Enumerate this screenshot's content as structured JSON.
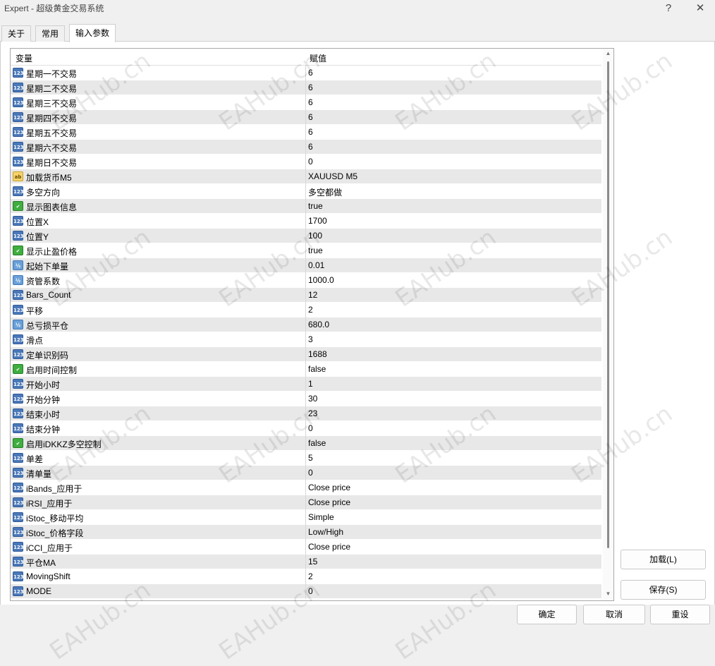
{
  "window": {
    "title": "Expert - 超级黄金交易系统",
    "help_label": "?",
    "close_label": "✕"
  },
  "tabs": [
    "关于",
    "常用",
    "输入参数"
  ],
  "grid": {
    "col_variable": "变量",
    "col_value": "赋值",
    "rows": [
      {
        "icon": "int",
        "icon_text": "123",
        "name": "星期一不交易",
        "value": "6"
      },
      {
        "icon": "int",
        "icon_text": "123",
        "name": "星期二不交易",
        "value": "6"
      },
      {
        "icon": "int",
        "icon_text": "123",
        "name": "星期三不交易",
        "value": "6"
      },
      {
        "icon": "int",
        "icon_text": "123",
        "name": "星期四不交易",
        "value": "6"
      },
      {
        "icon": "int",
        "icon_text": "123",
        "name": "星期五不交易",
        "value": "6"
      },
      {
        "icon": "int",
        "icon_text": "123",
        "name": "星期六不交易",
        "value": "6"
      },
      {
        "icon": "int",
        "icon_text": "123",
        "name": "星期日不交易",
        "value": "0"
      },
      {
        "icon": "str",
        "icon_text": "ab",
        "name": "加载货币M5",
        "value": "XAUUSD M5"
      },
      {
        "icon": "int",
        "icon_text": "123",
        "name": "多空方向",
        "value": "多空都做"
      },
      {
        "icon": "bool",
        "icon_text": "✔",
        "name": "显示图表信息",
        "value": "true"
      },
      {
        "icon": "int",
        "icon_text": "123",
        "name": "位置X",
        "value": "1700"
      },
      {
        "icon": "int",
        "icon_text": "123",
        "name": "位置Y",
        "value": "100"
      },
      {
        "icon": "bool",
        "icon_text": "✔",
        "name": "显示止盈价格",
        "value": "true"
      },
      {
        "icon": "dbl",
        "icon_text": "½",
        "name": "起始下单量",
        "value": "0.01"
      },
      {
        "icon": "dbl",
        "icon_text": "½",
        "name": "资管系数",
        "value": "1000.0"
      },
      {
        "icon": "int",
        "icon_text": "123",
        "name": "Bars_Count",
        "value": "12"
      },
      {
        "icon": "int",
        "icon_text": "123",
        "name": "平移",
        "value": "2"
      },
      {
        "icon": "dbl",
        "icon_text": "½",
        "name": "总亏损平仓",
        "value": "680.0"
      },
      {
        "icon": "int",
        "icon_text": "123",
        "name": "滑点",
        "value": "3"
      },
      {
        "icon": "int",
        "icon_text": "123",
        "name": "定单识别码",
        "value": "1688"
      },
      {
        "icon": "bool",
        "icon_text": "✔",
        "name": "启用时间控制",
        "value": "false"
      },
      {
        "icon": "int",
        "icon_text": "123",
        "name": "开始小时",
        "value": "1"
      },
      {
        "icon": "int",
        "icon_text": "123",
        "name": "开始分钟",
        "value": "30"
      },
      {
        "icon": "int",
        "icon_text": "123",
        "name": "结束小时",
        "value": "23"
      },
      {
        "icon": "int",
        "icon_text": "123",
        "name": "结束分钟",
        "value": "0"
      },
      {
        "icon": "bool",
        "icon_text": "✔",
        "name": "启用iDKKZ多空控制",
        "value": "false"
      },
      {
        "icon": "int",
        "icon_text": "123",
        "name": "单差",
        "value": "5"
      },
      {
        "icon": "int",
        "icon_text": "123",
        "name": "清单量",
        "value": "0"
      },
      {
        "icon": "int",
        "icon_text": "123",
        "name": "iBands_应用于",
        "value": "Close price"
      },
      {
        "icon": "int",
        "icon_text": "123",
        "name": "iRSI_应用于",
        "value": "Close price"
      },
      {
        "icon": "int",
        "icon_text": "123",
        "name": "iStoc_移动平均",
        "value": "Simple"
      },
      {
        "icon": "int",
        "icon_text": "123",
        "name": "iStoc_价格字段",
        "value": "Low/High"
      },
      {
        "icon": "int",
        "icon_text": "123",
        "name": "iCCI_应用于",
        "value": "Close price"
      },
      {
        "icon": "int",
        "icon_text": "123",
        "name": "平仓MA",
        "value": "15"
      },
      {
        "icon": "int",
        "icon_text": "123",
        "name": "MovingShift",
        "value": "2"
      },
      {
        "icon": "int",
        "icon_text": "123",
        "name": "MODE",
        "value": "0"
      }
    ]
  },
  "buttons": {
    "load": "加载(L)",
    "save": "保存(S)",
    "ok": "确定",
    "cancel": "取消",
    "reset": "重设"
  },
  "watermark_text": "EAHub.cn"
}
